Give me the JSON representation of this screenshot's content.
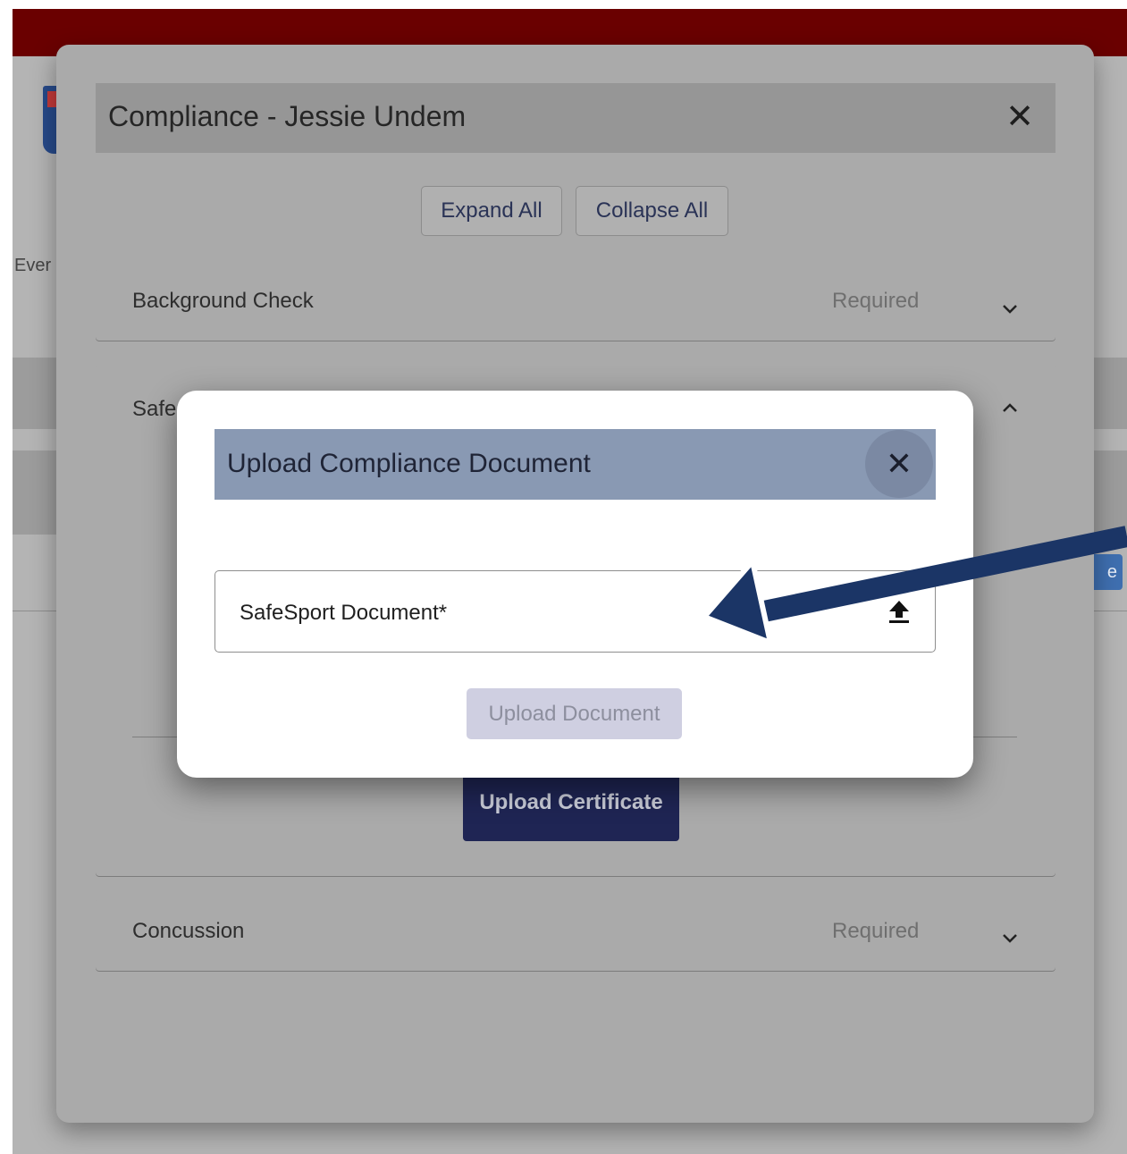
{
  "background": {
    "nav_fragment": "Ever",
    "button_fragment": "e"
  },
  "dialog": {
    "title": "Compliance - Jessie Undem",
    "close_icon": "close-icon",
    "expand_all_label": "Expand All",
    "collapse_all_label": "Collapse All",
    "sections": [
      {
        "title": "Background Check",
        "status": "Required",
        "expanded": false
      },
      {
        "title": "Safe",
        "status": "",
        "expanded": true
      },
      {
        "title": "Concussion",
        "status": "Required",
        "expanded": false
      }
    ],
    "upload_certificate_label": "Upload Certificate"
  },
  "modal": {
    "title": "Upload Compliance Document",
    "close_icon": "close-icon",
    "file_field_label": "SafeSport Document*",
    "file_icon": "upload-icon",
    "submit_label": "Upload Document",
    "submit_enabled": false
  },
  "annotation": {
    "arrow_color": "#1b3566"
  },
  "colors": {
    "topbar": "#6a0000",
    "modal_header": "#8999b3",
    "primary_button": "#1f2554",
    "disabled_button": "#cfcfe1"
  }
}
